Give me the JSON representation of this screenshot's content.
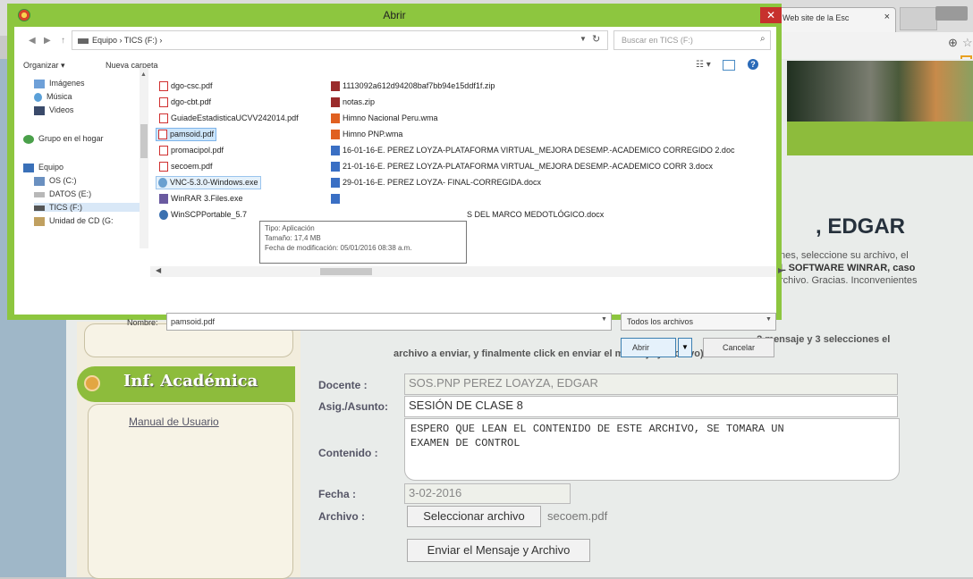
{
  "browser": {
    "tab_title": "Web site de la Esc",
    "tab_close": "×",
    "profile_label": "",
    "zoom_icon": "zoom-icon",
    "star_icon": "star-icon"
  },
  "page": {
    "teacher_name_partial": ", EDGAR",
    "intro_lines": [
      "nes, seleccione su archivo, el",
      "L SOFTWARE WINRAR, caso",
      "rchivo. Gracias. Inconvenientes"
    ],
    "instructions_line1": ". 2 mensaje y 3 selecciones el",
    "instructions_line2": "archivo a enviar, y finalmente click en enviar el mensaje y archivo)",
    "menu_academic": "Inf. Académica",
    "manual_link": "Manual de Usuario",
    "form": {
      "docente_label": "Docente :",
      "docente_value": "SOS.PNP PEREZ LOAYZA, EDGAR",
      "asunto_label": "Asig./Asunto:",
      "asunto_value": "SESIÓN DE CLASE 8",
      "contenido_label": "Contenido :",
      "contenido_value": "ESPERO QUE LEAN EL CONTENIDO DE ESTE ARCHIVO, SE TOMARA UN\nEXAMEN DE CONTROL",
      "fecha_label": "Fecha :",
      "fecha_value": "3-02-2016",
      "archivo_label": "Archivo :",
      "choose_file": "Seleccionar archivo",
      "chosen_file": "secoem.pdf",
      "send_button": "Enviar el Mensaje y Archivo"
    }
  },
  "dialog": {
    "title": "Abrir",
    "close": "✕",
    "path": "Equipo  ›  TICS (F:)  ›",
    "path_sep": "›",
    "search_placeholder": "Buscar en TICS (F:)",
    "organize": "Organizar ▾",
    "new_folder": "Nueva carpeta",
    "nav_items": [
      {
        "label": "Imágenes",
        "icon": "pictures-icon"
      },
      {
        "label": "Música",
        "icon": "music-icon"
      },
      {
        "label": "Videos",
        "icon": "videos-icon"
      },
      {
        "label": "Grupo en el hogar",
        "icon": "homegroup-icon"
      },
      {
        "label": "Equipo",
        "icon": "computer-icon"
      },
      {
        "label": "OS (C:)",
        "icon": "drive-icon"
      },
      {
        "label": "DATOS (E:)",
        "icon": "drive-icon"
      },
      {
        "label": "TICS (F:)",
        "icon": "usb-drive-icon"
      },
      {
        "label": "Unidad de CD (G:",
        "icon": "cd-drive-icon"
      }
    ],
    "files_col1": [
      {
        "name": "dgo-csc.pdf",
        "icon": "pdf-icon"
      },
      {
        "name": "dgo-cbt.pdf",
        "icon": "pdf-icon"
      },
      {
        "name": "GuiadeEstadisticaUCVV242014.pdf",
        "icon": "pdf-icon"
      },
      {
        "name": "pamsoid.pdf",
        "icon": "pdf-icon"
      },
      {
        "name": "promacipol.pdf",
        "icon": "pdf-icon"
      },
      {
        "name": "secoem.pdf",
        "icon": "pdf-icon"
      },
      {
        "name": "VNC-5.3.0-Windows.exe",
        "icon": "exe-icon"
      },
      {
        "name": "WinRAR 3.Files.exe",
        "icon": "winrar-icon"
      },
      {
        "name": "WinSCPPortable_5.7",
        "icon": "winscp-icon"
      }
    ],
    "files_col2": [
      {
        "name": "1113092a612d94208baf7bb94e15ddf1f.zip",
        "icon": "zip-icon"
      },
      {
        "name": "notas.zip",
        "icon": "zip-icon"
      },
      {
        "name": "Himno Nacional Peru.wma",
        "icon": "wma-icon"
      },
      {
        "name": "Himno PNP.wma",
        "icon": "wma-icon"
      },
      {
        "name": "16-01-16-E. PEREZ LOYZA-PLATAFORMA VIRTUAL_MEJORA DESEMP.-ACADEMICO CORREGIDO 2.doc",
        "icon": "word-icon"
      },
      {
        "name": "21-01-16-E. PEREZ LOYZA-PLATAFORMA VIRTUAL_MEJORA DESEMP.-ACADEMICO CORR 3.docx",
        "icon": "word-icon"
      },
      {
        "name": "29-01-16-E. PEREZ LOYZA- FINAL-CORREGIDA.docx",
        "icon": "word-icon"
      },
      {
        "name": "",
        "icon": "word-icon"
      },
      {
        "name": "S DEL MARCO MEDOTLÓGICO.docx",
        "icon": "word-icon"
      }
    ],
    "tooltip_lines": [
      "Tipo: Aplicación",
      "Tamaño: 17,4 MB",
      "Fecha de modificación: 05/01/2016 08:38 a.m."
    ],
    "filename_label": "Nombre:",
    "filename_value": "pamsoid.pdf",
    "filetype": "Todos los archivos",
    "open": "Abrir",
    "cancel": "Cancelar"
  },
  "colors": {
    "dialog_frame": "#8dc63f",
    "menu_green": "#8dbc3c",
    "close_red": "#c7312d",
    "selection_blue": "#cde6fb"
  }
}
